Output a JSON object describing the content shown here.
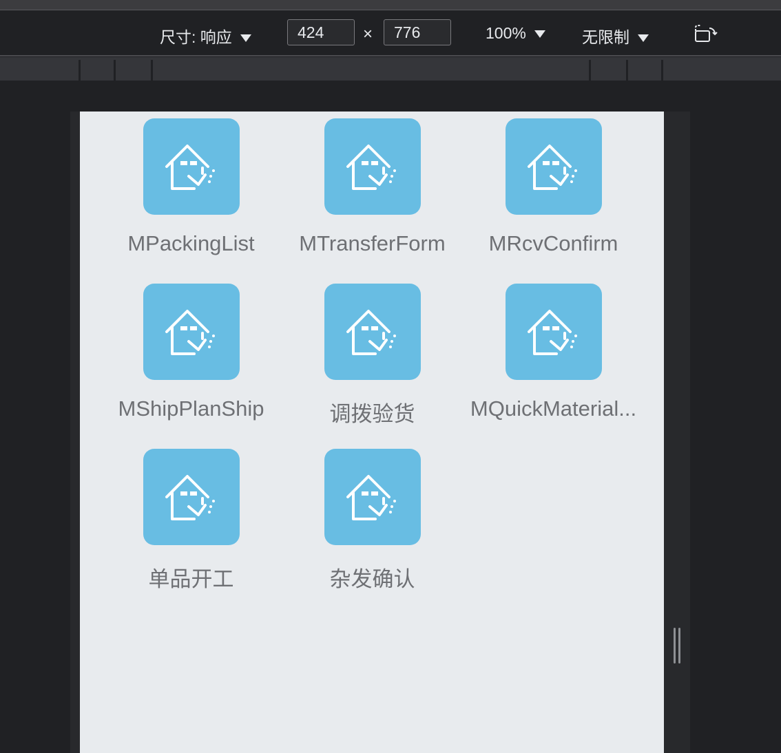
{
  "toolbar": {
    "size_label": "尺寸: 响应",
    "width_value": "424",
    "height_value": "776",
    "times_symbol": "×",
    "zoom_label": "100%",
    "throttle_label": "无限制"
  },
  "apps": [
    {
      "label": "MPackingList"
    },
    {
      "label": "MTransferForm"
    },
    {
      "label": "MRcvConfirm"
    },
    {
      "label": "MShipPlanShip"
    },
    {
      "label": "调拨验货"
    },
    {
      "label": "MQuickMaterial..."
    },
    {
      "label": "单品开工"
    },
    {
      "label": "杂发确认"
    }
  ],
  "icons": {
    "app_icon": "warehouse-icon",
    "rotate": "rotate-device-icon",
    "dropdown": "triangle-down-icon"
  },
  "colors": {
    "accent_tile": "#68bde3",
    "page_bg": "#e8ebee",
    "label_text": "#6e7074",
    "devtools_bg": "#202124"
  }
}
